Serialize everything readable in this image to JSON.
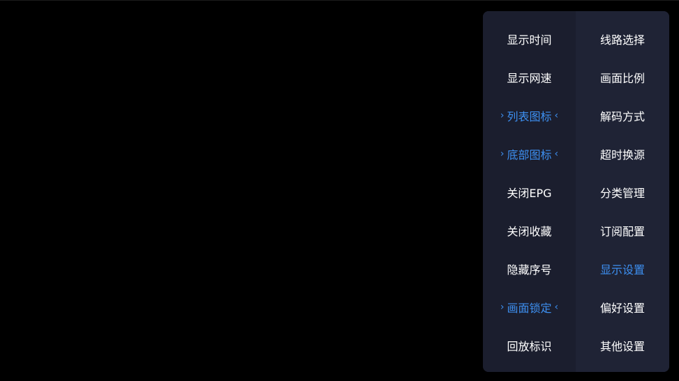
{
  "colors": {
    "background": "#000000",
    "panel": "#1b1e2e",
    "panel_right": "#1f2335",
    "text": "#ffffff",
    "accent": "#3d8ff0"
  },
  "settings_menu": {
    "options": [
      {
        "label": "显示时间",
        "selected": false
      },
      {
        "label": "显示网速",
        "selected": false
      },
      {
        "label": "列表图标",
        "selected": true
      },
      {
        "label": "底部图标",
        "selected": true
      },
      {
        "label": "关闭EPG",
        "selected": false
      },
      {
        "label": "关闭收藏",
        "selected": false
      },
      {
        "label": "隐藏序号",
        "selected": false
      },
      {
        "label": "画面锁定",
        "selected": true
      },
      {
        "label": "回放标识",
        "selected": false
      }
    ],
    "categories": [
      {
        "label": "线路选择",
        "active": false
      },
      {
        "label": "画面比例",
        "active": false
      },
      {
        "label": "解码方式",
        "active": false
      },
      {
        "label": "超时换源",
        "active": false
      },
      {
        "label": "分类管理",
        "active": false
      },
      {
        "label": "订阅配置",
        "active": false
      },
      {
        "label": "显示设置",
        "active": true
      },
      {
        "label": "偏好设置",
        "active": false
      },
      {
        "label": "其他设置",
        "active": false
      }
    ],
    "selected_marker_left": "›",
    "selected_marker_right": "‹"
  }
}
